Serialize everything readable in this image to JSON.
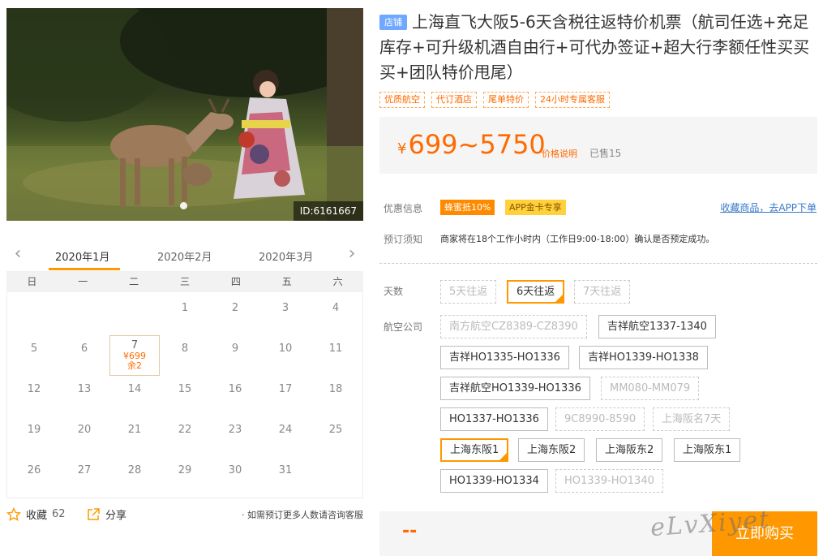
{
  "photo": {
    "id_label": "ID:6161667",
    "icon": "photo-deer-kimono"
  },
  "calendar": {
    "prev_icon": "chevron-left-icon",
    "next_icon": "chevron-right-icon",
    "months": [
      "2020年1月",
      "2020年2月",
      "2020年3月"
    ],
    "active_month_index": 0,
    "weekdays": [
      "日",
      "一",
      "二",
      "三",
      "四",
      "五",
      "六"
    ],
    "weeks": [
      [
        "",
        "",
        "",
        "1",
        "2",
        "3",
        "4"
      ],
      [
        "5",
        "6",
        "7",
        "8",
        "9",
        "10",
        "11"
      ],
      [
        "12",
        "13",
        "14",
        "15",
        "16",
        "17",
        "18"
      ],
      [
        "19",
        "20",
        "21",
        "22",
        "23",
        "24",
        "25"
      ],
      [
        "26",
        "27",
        "28",
        "29",
        "30",
        "31",
        ""
      ]
    ],
    "selected": {
      "day": "7",
      "price": "¥699",
      "stock": "余2"
    }
  },
  "actions": {
    "favorite_label": "收藏",
    "favorite_count": "62",
    "share_label": "分享",
    "note": "· 如需预订更多人数请咨询客服"
  },
  "product": {
    "shop_badge": "店铺",
    "title": "上海直飞大阪5-6天含税往返特价机票（航司任选+充足库存+可升级机酒自由行+可代办签证+超大行李额任性买买买+团队特价甩尾）",
    "tags": [
      "优质航空",
      "代订酒店",
      "尾单特价",
      "24小时专属客服"
    ],
    "currency": "¥",
    "price": "699~5750",
    "price_explain": "价格说明",
    "sold": "已售15"
  },
  "info": {
    "promo_label": "优惠信息",
    "promo_badges": [
      "蜂蜜抵10%",
      "APP金卡专享"
    ],
    "collect_link": "收藏商品，去APP下单",
    "notice_label": "预订须知",
    "notice_text": "商家将在18个工作小时内（工作日9:00-18:00）确认是否预定成功。"
  },
  "options": {
    "days_label": "天数",
    "days": [
      "5天往返",
      "6天往返",
      "7天往返"
    ],
    "airline_label": "航空公司",
    "airlines": [
      "南方航空CZ8389-CZ8390",
      "吉祥航空1337-1340",
      "吉祥HO1335-HO1336",
      "吉祥HO1339-HO1338",
      "吉祥航空HO1339-HO1336",
      "MM080-MM079",
      "HO1337-HO1336",
      "9C8990-8590",
      "上海阪名7天",
      "上海东阪1",
      "上海东阪2",
      "上海阪东2",
      "上海阪东1",
      "HO1339-HO1334",
      "HO1339-HO1340"
    ]
  },
  "buy": {
    "price_placeholder": "--",
    "button": "立即购买"
  },
  "watermark": "eLvXiyet",
  "colors": {
    "accent": "#ff9800",
    "price": "#ff6a00",
    "link": "#3a78c9",
    "badge": "#6fa8ff"
  }
}
